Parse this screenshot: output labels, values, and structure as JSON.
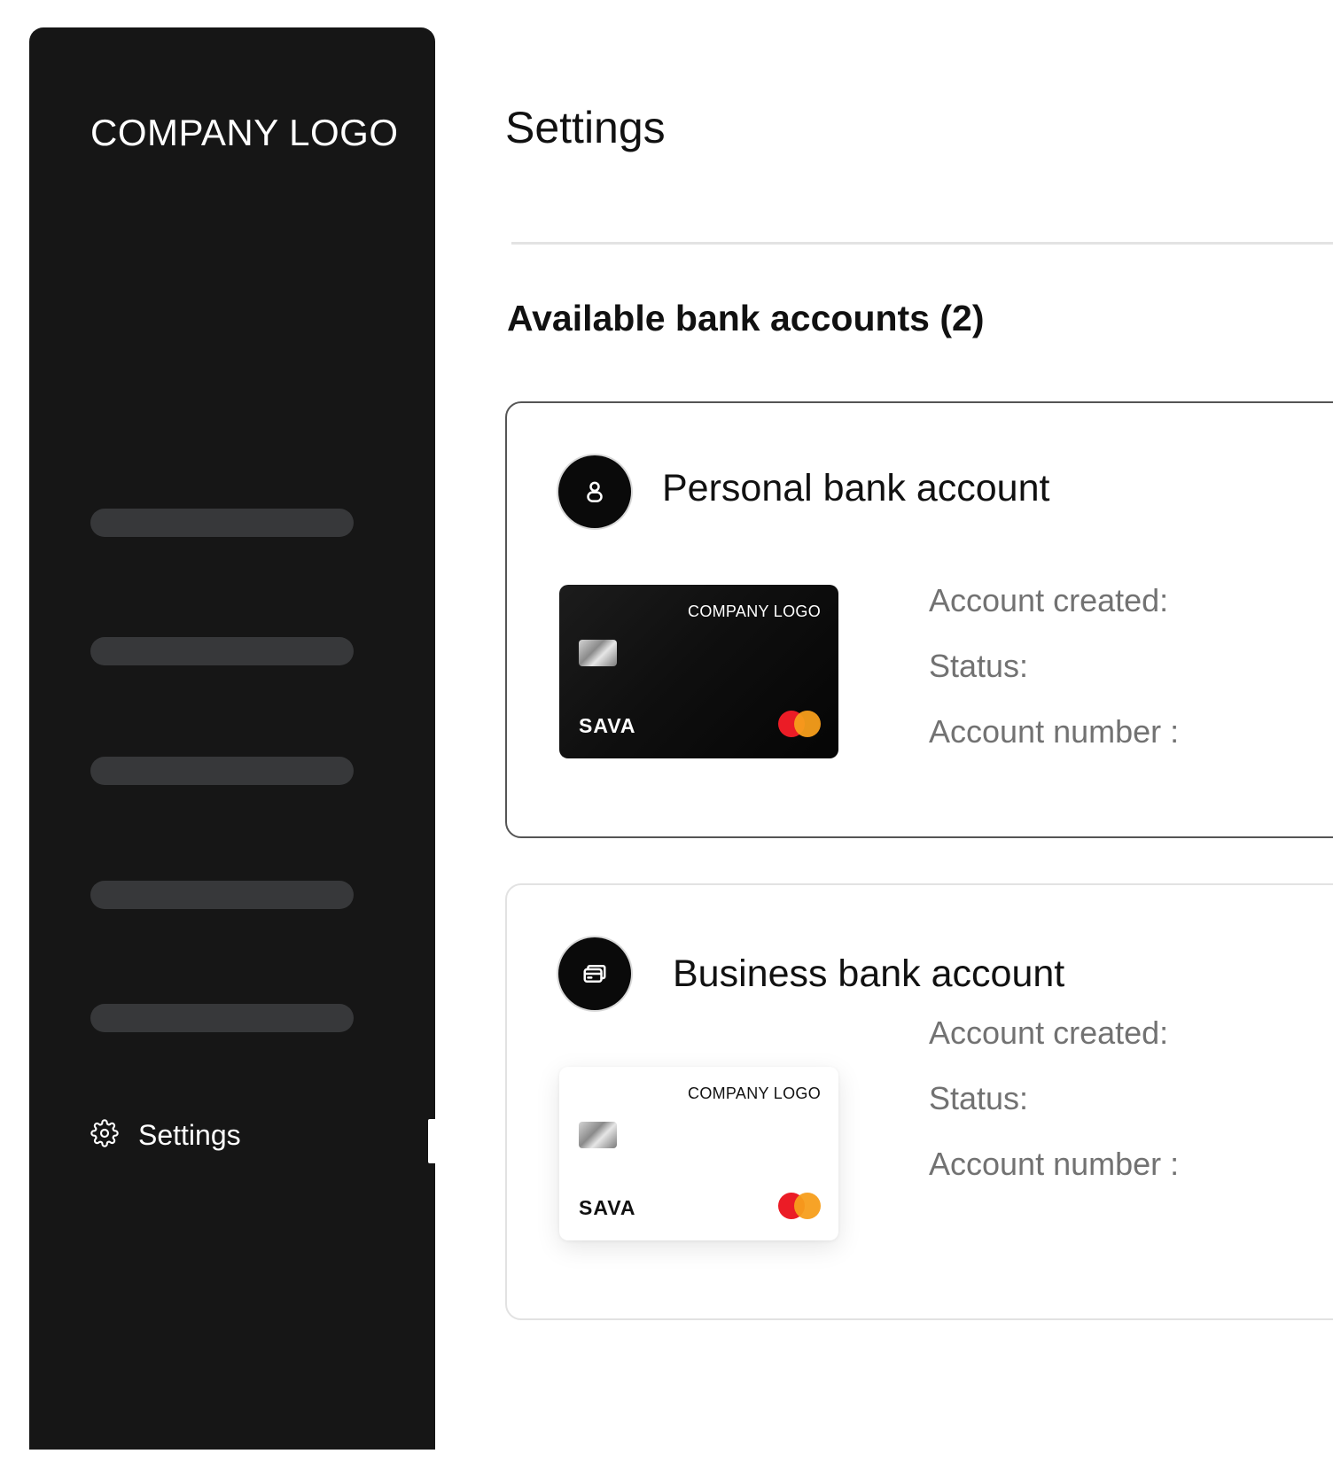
{
  "sidebar": {
    "logo": "COMPANY LOGO",
    "nav_placeholders": 5,
    "settings_label": "Settings",
    "settings_icon": "gear-icon"
  },
  "main": {
    "title": "Settings",
    "section_title": "Available bank accounts (2)",
    "accounts": [
      {
        "title": "Personal bank account",
        "icon": "user-icon",
        "card": {
          "theme": "dark",
          "logo": "COMPANY LOGO",
          "brand": "SAVA",
          "network_icon": "mastercard-icon"
        },
        "fields": [
          "Account created:",
          "Status:",
          "Account number :"
        ]
      },
      {
        "title": "Business bank account",
        "icon": "cards-icon",
        "card": {
          "theme": "light",
          "logo": "COMPANY LOGO",
          "brand": "SAVA",
          "network_icon": "mastercard-icon"
        },
        "fields": [
          "Account created:",
          "Status:",
          "Account number :"
        ]
      }
    ]
  },
  "colors": {
    "sidebar_bg": "#161616",
    "nav_placeholder": "#37383a",
    "detail_text": "#727272",
    "mastercard_red": "#eb1c26",
    "mastercard_orange": "#f79e1b"
  }
}
